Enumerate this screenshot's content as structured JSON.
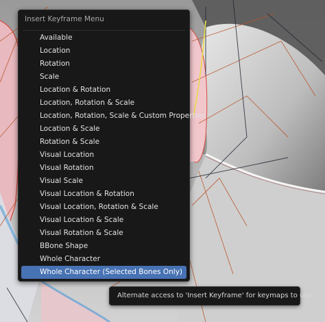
{
  "menu": {
    "title": "Insert Keyframe Menu",
    "items": [
      {
        "label": "Available"
      },
      {
        "label": "Location"
      },
      {
        "label": "Rotation"
      },
      {
        "label": "Scale"
      },
      {
        "label": "Location & Rotation"
      },
      {
        "label": "Location, Rotation & Scale"
      },
      {
        "label": "Location, Rotation, Scale & Custom Properties"
      },
      {
        "label": "Location & Scale"
      },
      {
        "label": "Rotation & Scale"
      },
      {
        "label": "Visual Location"
      },
      {
        "label": "Visual Rotation"
      },
      {
        "label": "Visual Scale"
      },
      {
        "label": "Visual Location & Rotation"
      },
      {
        "label": "Visual Location, Rotation & Scale"
      },
      {
        "label": "Visual Location & Scale"
      },
      {
        "label": "Visual Rotation & Scale"
      },
      {
        "label": "BBone Shape"
      },
      {
        "label": "Whole Character"
      },
      {
        "label": "Whole Character (Selected Bones Only)"
      }
    ],
    "active_item": "Whole Character (Selected Bones Only)"
  },
  "tooltip": {
    "text": "Alternate access to 'Insert Keyframe' for keymaps to use."
  },
  "colors": {
    "menu_bg": "#181818",
    "highlight": "#4772b3",
    "text": "#e2e2e2",
    "title_text": "#a8a8a8"
  }
}
